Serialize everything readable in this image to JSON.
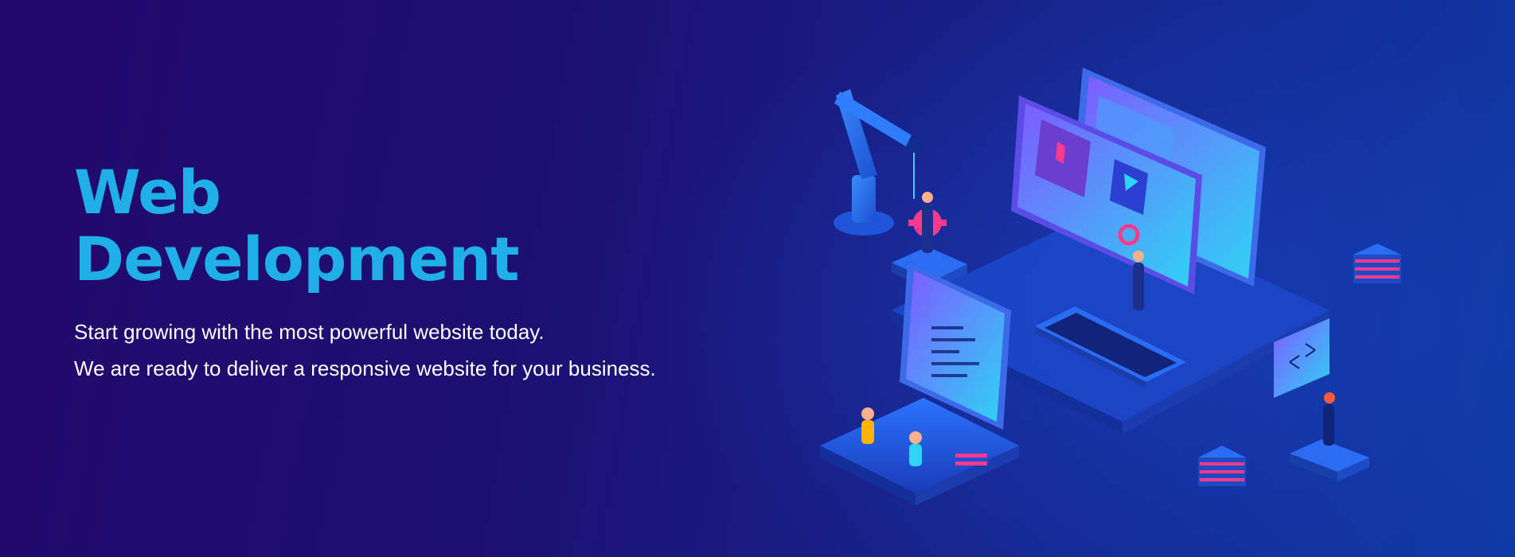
{
  "hero": {
    "title_line1": "Web",
    "title_line2": "Development",
    "subtitle_line1": "Start growing with the most powerful website today.",
    "subtitle_line2": "We are ready to deliver a responsive website for your business."
  },
  "colors": {
    "background_left": "#22096b",
    "background_right": "#0f3aa6",
    "title": "#1fb0e8",
    "subtitle": "#ffffff",
    "accent_cyan": "#2fd3f5",
    "accent_pink": "#ff3a8c"
  },
  "illustration": {
    "icons": [
      "robot-arm-icon",
      "monitor-icon",
      "code-window-icon",
      "keyboard-icon",
      "server-stack-icon",
      "person-icon",
      "gear-icon"
    ]
  }
}
